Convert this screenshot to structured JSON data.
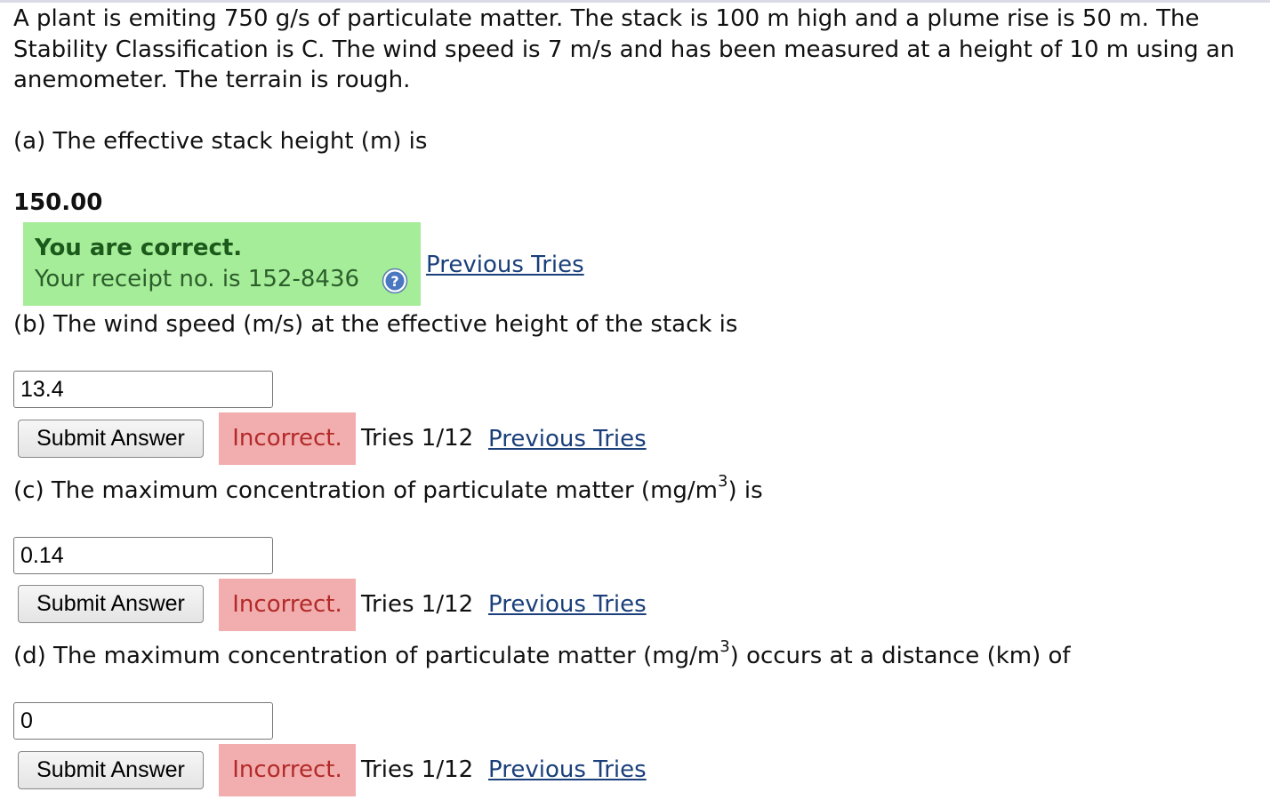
{
  "problem": {
    "line1": "A plant is emiting 750 g/s of particulate matter. The stack is 100 m high and a plume rise is 50 m. The",
    "line2": "Stability Classification is C. The wind speed is 7 m/s and has been measured at a height of 10 m using an",
    "line3": "anemometer. The terrain is rough."
  },
  "part_a": {
    "question": "(a) The effective stack height (m) is",
    "answer": "150.00",
    "status_title": "You are correct.",
    "receipt": "Your receipt no. is 152-8436",
    "help_icon": "question-circle-icon",
    "previous_tries": "Previous Tries"
  },
  "part_b": {
    "question": "(b) The wind speed (m/s) at the effective height of the stack is",
    "value": "13.4",
    "submit": "Submit Answer",
    "status": "Incorrect.",
    "tries": "Tries 1/12",
    "previous_tries": "Previous Tries"
  },
  "part_c": {
    "question_pre": "(c) The maximum concentration of particulate matter (mg/m",
    "question_sup": "3",
    "question_post": ") is",
    "value": "0.14",
    "submit": "Submit Answer",
    "status": "Incorrect.",
    "tries": "Tries 1/12",
    "previous_tries": "Previous Tries"
  },
  "part_d": {
    "question_pre": "(d) The maximum concentration of particulate matter (mg/m",
    "question_sup": "3",
    "question_post": ") occurs at a distance (km) of",
    "value": "0",
    "submit": "Submit Answer",
    "status": "Incorrect.",
    "tries": "Tries 1/12",
    "previous_tries": "Previous Tries"
  },
  "colors": {
    "correct_bg": "#a5ed98",
    "incorrect_bg": "#f2aeae",
    "link": "#1a3f7a"
  }
}
